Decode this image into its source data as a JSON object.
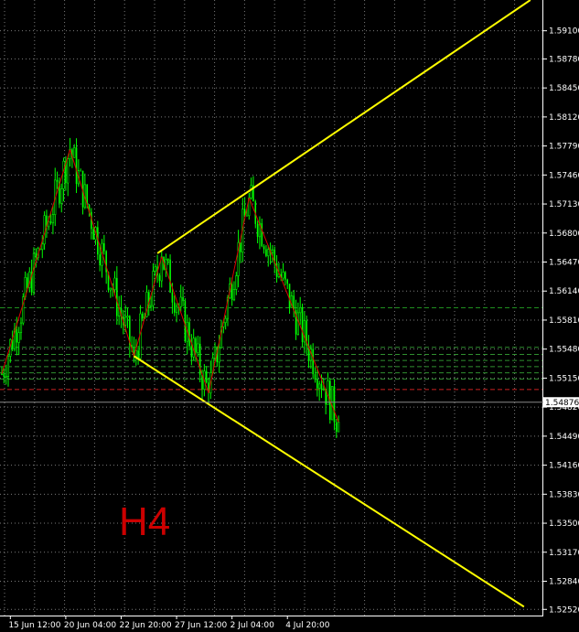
{
  "chart_data": {
    "type": "candlestick",
    "timeframe_label": "H4",
    "y_ticks": [
      "1.59100",
      "1.58780",
      "1.58450",
      "1.58120",
      "1.57790",
      "1.57460",
      "1.57130",
      "1.56800",
      "1.56470",
      "1.56140",
      "1.55810",
      "1.55480",
      "1.55150",
      "1.54820",
      "1.54490",
      "1.54160",
      "1.53830",
      "1.53500",
      "1.53170",
      "1.52840",
      "1.52520"
    ],
    "y_tick_values": [
      1.591,
      1.5878,
      1.5845,
      1.5812,
      1.5779,
      1.5746,
      1.5713,
      1.568,
      1.5647,
      1.5614,
      1.5581,
      1.5548,
      1.5515,
      1.5482,
      1.5449,
      1.5416,
      1.5383,
      1.535,
      1.5317,
      1.5284,
      1.5252
    ],
    "ylim": [
      1.5245,
      1.5945
    ],
    "current_price": "1.54876",
    "current_price_value": 1.54876,
    "x_ticks": [
      "15 Jun 12:00",
      "20 Jun 04:00",
      "22 Jun 20:00",
      "27 Jun 12:00",
      "2 Jul 04:00",
      "4 Jul 20:00"
    ],
    "x_tick_bars": [
      4,
      30,
      56,
      82,
      108,
      134
    ],
    "zigzag": [
      {
        "bar": 0,
        "price": 1.552
      },
      {
        "bar": 32,
        "price": 1.5775
      },
      {
        "bar": 62,
        "price": 1.554
      },
      {
        "bar": 75,
        "price": 1.5653
      },
      {
        "bar": 97,
        "price": 1.5498
      },
      {
        "bar": 116,
        "price": 1.572
      },
      {
        "bar": 158,
        "price": 1.5465
      }
    ],
    "upper_trendline": [
      {
        "bar": 73,
        "price": 1.5657
      },
      {
        "bar": 248,
        "price": 1.5945
      }
    ],
    "lower_trendline": [
      {
        "bar": 62,
        "price": 1.554
      },
      {
        "bar": 245,
        "price": 1.5255
      }
    ],
    "horizontal_levels": [
      {
        "price": 1.5595,
        "color": "#1f8f1f"
      },
      {
        "price": 1.555,
        "color": "#2f8f2f"
      },
      {
        "price": 1.5542,
        "color": "#2f8f2f"
      },
      {
        "price": 1.5535,
        "color": "#2f8f2f"
      },
      {
        "price": 1.5528,
        "color": "#2f8f2f"
      },
      {
        "price": 1.5521,
        "color": "#2f8f2f"
      },
      {
        "price": 1.5514,
        "color": "#2f8f2f"
      },
      {
        "price": 1.5502,
        "color": "#cc2222"
      }
    ],
    "candle_color": "#00ff00",
    "zigzag_color": "#dd0000",
    "trendline_color": "#ffff00",
    "grid": true,
    "bar_count": 158
  }
}
